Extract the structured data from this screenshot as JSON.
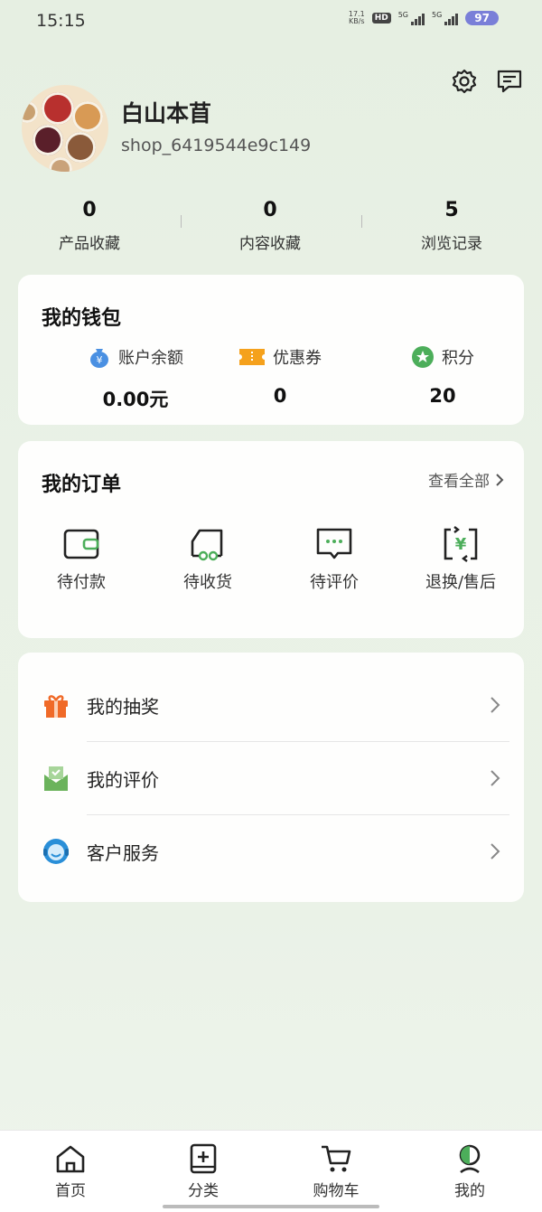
{
  "status_bar": {
    "time": "15:15",
    "net_speed_value": "17.1",
    "net_speed_unit": "KB/s",
    "hd_label": "HD",
    "sim1_label": "5G",
    "sim2_label": "5G",
    "battery": "97"
  },
  "profile": {
    "name": "白山本苜",
    "shop_id": "shop_6419544e9c149"
  },
  "stats": [
    {
      "value": "0",
      "label": "产品收藏"
    },
    {
      "value": "0",
      "label": "内容收藏"
    },
    {
      "value": "5",
      "label": "浏览记录"
    }
  ],
  "wallet": {
    "title": "我的钱包",
    "items": [
      {
        "label": "账户余额",
        "value": "0.00元",
        "icon": "money-bag-icon"
      },
      {
        "label": "优惠券",
        "value": "0",
        "icon": "coupon-icon"
      },
      {
        "label": "积分",
        "value": "20",
        "icon": "star-badge-icon"
      }
    ]
  },
  "orders": {
    "title": "我的订单",
    "view_all": "查看全部",
    "items": [
      {
        "label": "待付款",
        "icon": "wallet-icon"
      },
      {
        "label": "待收货",
        "icon": "delivery-truck-icon"
      },
      {
        "label": "待评价",
        "icon": "comment-icon"
      },
      {
        "label": "退换/售后",
        "icon": "refund-icon"
      }
    ]
  },
  "menu": [
    {
      "label": "我的抽奖",
      "icon": "gift-icon"
    },
    {
      "label": "我的评价",
      "icon": "review-envelope-icon"
    },
    {
      "label": "客户服务",
      "icon": "customer-service-icon"
    }
  ],
  "bottom_nav": [
    {
      "label": "首页",
      "icon": "home-icon"
    },
    {
      "label": "分类",
      "icon": "category-icon"
    },
    {
      "label": "购物车",
      "icon": "cart-icon"
    },
    {
      "label": "我的",
      "icon": "profile-icon"
    }
  ],
  "colors": {
    "background": "#e8f0e5",
    "coupon_orange": "#f5a11c",
    "money_blue": "#4a90e2",
    "points_green": "#4cae5a",
    "gift_orange": "#f06a28",
    "service_blue": "#2a8fd8",
    "battery_purple": "#7a7fd8"
  }
}
